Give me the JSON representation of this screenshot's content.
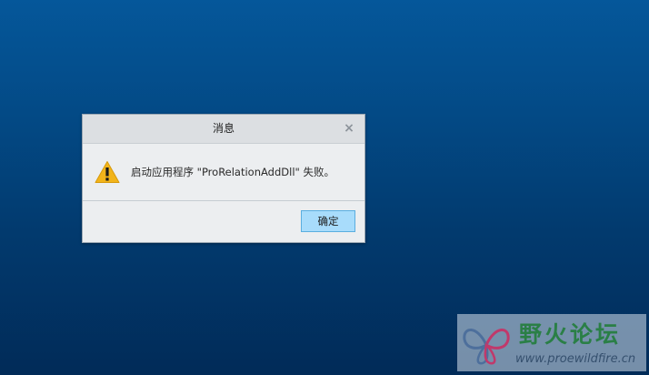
{
  "dialog": {
    "title": "消息",
    "close_icon": "×",
    "message_icon": "warning-triangle-icon",
    "message": "启动应用程序 \"ProRelationAddDll\" 失败。",
    "ok_label": "确定"
  },
  "watermark": {
    "logo": "proewildfire-butterfly-logo",
    "title": "野火论坛",
    "url": "www.proewildfire.cn"
  },
  "colors": {
    "desktop_top": "#05579a",
    "desktop_bottom": "#012b58",
    "dialog_bg": "#eceef0",
    "titlebar_bg": "#dcdfe2",
    "button_bg": "#a8dcfb",
    "button_border": "#5aaedf",
    "warning_fill": "#f2b41a",
    "watermark_green": "#2a7f46"
  }
}
